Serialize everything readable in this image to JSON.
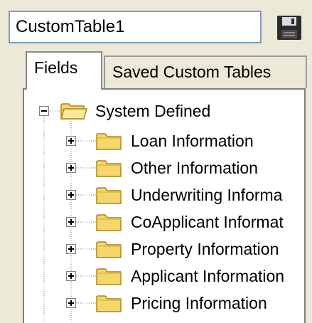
{
  "table_name": {
    "value": "CustomTable1"
  },
  "save_icon": "floppy-disk-icon",
  "tabs": [
    {
      "label": "Fields",
      "active": true
    },
    {
      "label": "Saved Custom Tables",
      "active": false
    }
  ],
  "tree": {
    "root": {
      "label": "System Defined",
      "expanded": true,
      "icon": "open-folder-icon",
      "children": [
        {
          "label": "Loan Information",
          "expanded": false
        },
        {
          "label": "Other Information",
          "expanded": false
        },
        {
          "label": "Underwriting Informa",
          "expanded": false
        },
        {
          "label": "CoApplicant Informat",
          "expanded": false
        },
        {
          "label": "Property Information",
          "expanded": false
        },
        {
          "label": "Applicant Information",
          "expanded": false
        },
        {
          "label": "Pricing Information",
          "expanded": false
        }
      ]
    }
  },
  "colors": {
    "panel_bg": "#ece9d8",
    "folder_fill": "#f5d66a",
    "folder_stroke": "#a8871e",
    "tree_line": "#808080"
  }
}
